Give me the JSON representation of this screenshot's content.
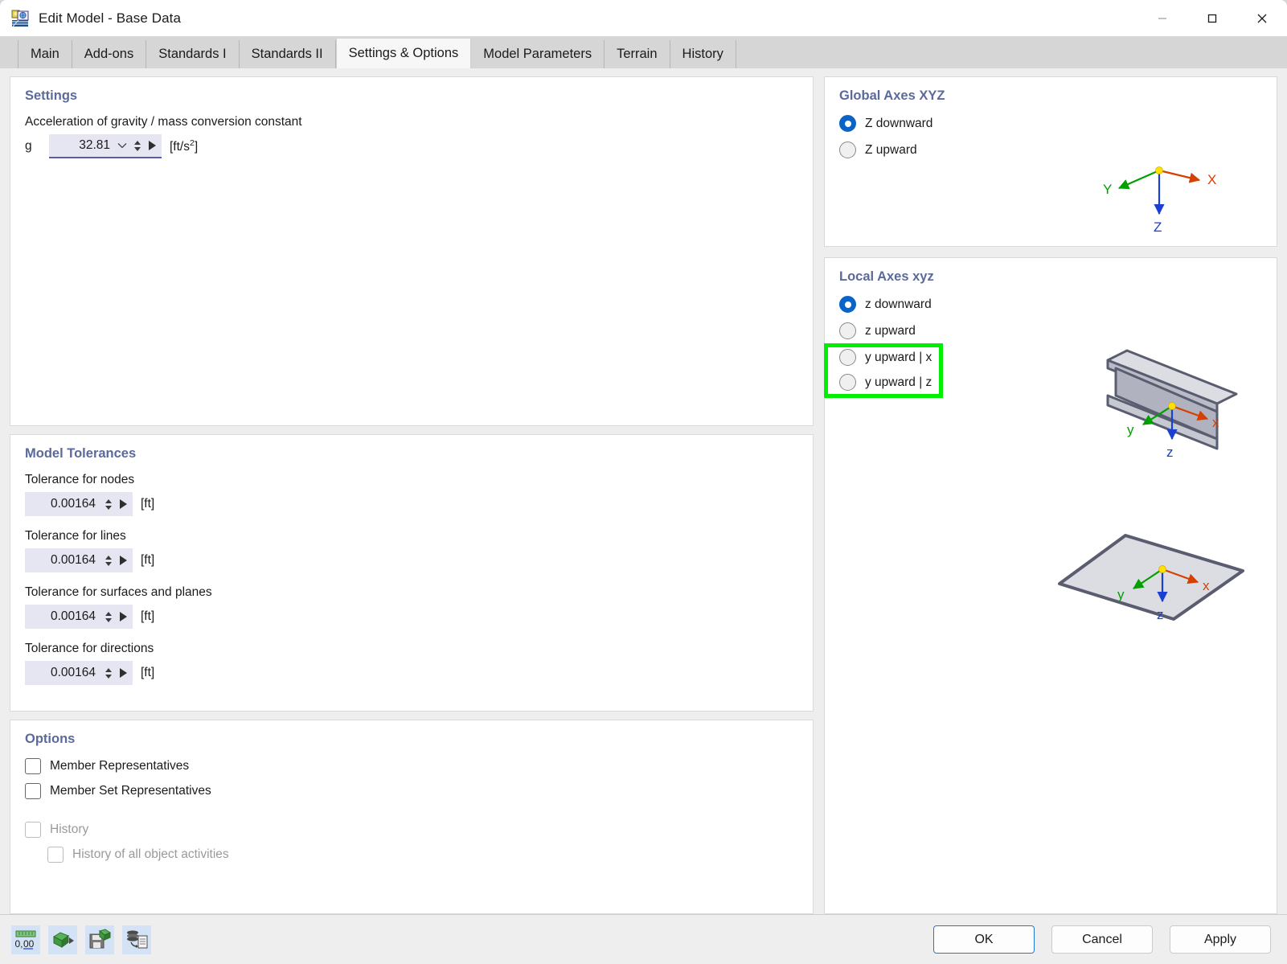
{
  "window": {
    "title": "Edit Model - Base Data",
    "app_icon": "app-logo-icon",
    "minimize_label": "—",
    "maximize_label": "□",
    "close_label": "✕"
  },
  "tabs": [
    {
      "label": "Main",
      "active": false
    },
    {
      "label": "Add-ons",
      "active": false
    },
    {
      "label": "Standards I",
      "active": false
    },
    {
      "label": "Standards II",
      "active": false
    },
    {
      "label": "Settings & Options",
      "active": true
    },
    {
      "label": "Model Parameters",
      "active": false
    },
    {
      "label": "Terrain",
      "active": false
    },
    {
      "label": "History",
      "active": false
    }
  ],
  "settings": {
    "title": "Settings",
    "gravity_label": "Acceleration of gravity / mass conversion constant",
    "gravity_symbol": "g",
    "gravity_value": "32.81",
    "gravity_unit_prefix": "[ft/s",
    "gravity_unit_exponent": "2",
    "gravity_unit_suffix": "]"
  },
  "tolerances": {
    "title": "Model Tolerances",
    "items": [
      {
        "label": "Tolerance for nodes",
        "value": "0.00164",
        "unit": "[ft]"
      },
      {
        "label": "Tolerance for lines",
        "value": "0.00164",
        "unit": "[ft]"
      },
      {
        "label": "Tolerance for surfaces and planes",
        "value": "0.00164",
        "unit": "[ft]"
      },
      {
        "label": "Tolerance for directions",
        "value": "0.00164",
        "unit": "[ft]"
      }
    ]
  },
  "options": {
    "title": "Options",
    "items": [
      {
        "label": "Member Representatives",
        "checked": false,
        "disabled": false,
        "indent": false
      },
      {
        "label": "Member Set Representatives",
        "checked": false,
        "disabled": false,
        "indent": false
      },
      {
        "label": "History",
        "checked": false,
        "disabled": true,
        "indent": false
      },
      {
        "label": "History of all object activities",
        "checked": false,
        "disabled": true,
        "indent": true
      }
    ]
  },
  "global_axes": {
    "title": "Global Axes XYZ",
    "options": [
      {
        "label": "Z downward",
        "selected": true
      },
      {
        "label": "Z upward",
        "selected": false
      }
    ],
    "diagram": {
      "x_label": "X",
      "y_label": "Y",
      "z_label": "Z",
      "x_color": "#d64000",
      "y_color": "#00a000",
      "z_color": "#1a3fd2",
      "origin_color": "#ffe000"
    }
  },
  "local_axes": {
    "title": "Local Axes xyz",
    "options": [
      {
        "label": "z downward",
        "selected": true
      },
      {
        "label": "z upward",
        "selected": false
      },
      {
        "label": "y upward | x",
        "selected": false
      },
      {
        "label": "y upward | z",
        "selected": false
      }
    ],
    "highlight_color": "#00ee00",
    "member_diagram": {
      "x_label": "x",
      "y_label": "y",
      "z_label": "z",
      "shape": "i-beam"
    },
    "surface_diagram": {
      "x_label": "x",
      "y_label": "y",
      "z_label": "z",
      "shape": "plane"
    }
  },
  "footer": {
    "icons": [
      {
        "name": "decimal-places-icon",
        "label": "0,00"
      },
      {
        "name": "export-model-icon",
        "label": ""
      },
      {
        "name": "save-model-icon",
        "label": ""
      },
      {
        "name": "database-document-icon",
        "label": ""
      }
    ],
    "buttons": [
      {
        "label": "OK",
        "primary": true
      },
      {
        "label": "Cancel",
        "primary": false
      },
      {
        "label": "Apply",
        "primary": false
      }
    ]
  }
}
